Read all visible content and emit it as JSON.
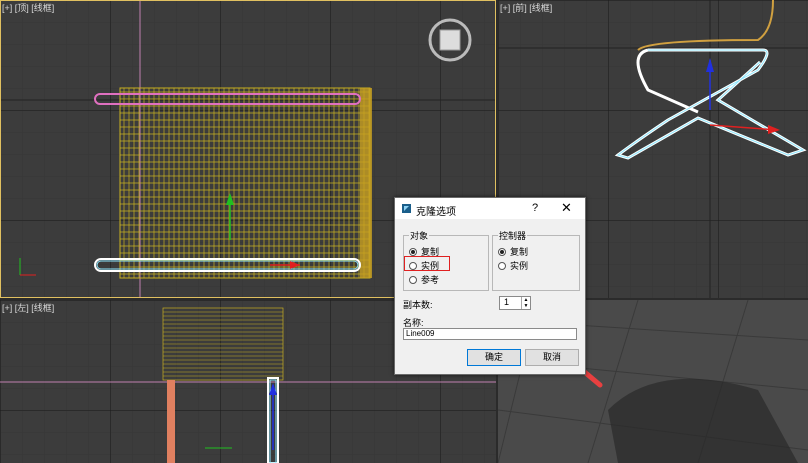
{
  "viewports": {
    "top": {
      "label": "[+] [顶] [线框]"
    },
    "front": {
      "label": "[+] [前] [线框]"
    },
    "left": {
      "label": "[+] [左] [线框]"
    },
    "perspective": {
      "label": ""
    }
  },
  "dialog": {
    "title": "克隆选项",
    "help": "?",
    "close": "✕",
    "object_group": {
      "title": "对象",
      "options": [
        {
          "label": "复制",
          "selected": true
        },
        {
          "label": "实例",
          "selected": false
        },
        {
          "label": "参考",
          "selected": false
        }
      ]
    },
    "controller_group": {
      "title": "控制器",
      "options": [
        {
          "label": "复制",
          "selected": true
        },
        {
          "label": "实例",
          "selected": false
        }
      ]
    },
    "copies_label": "副本数:",
    "copies_value": "1",
    "name_label": "名称:",
    "name_value": "Line009",
    "ok_label": "确定",
    "cancel_label": "取消"
  },
  "colors": {
    "object_yellow": "#c8b020",
    "selection_white": "#ffffff",
    "cyan_outline": "#8ee8ff",
    "pink_rail": "#e070c0",
    "highlight_red": "#e02020",
    "arrow_red": "#e84040"
  }
}
